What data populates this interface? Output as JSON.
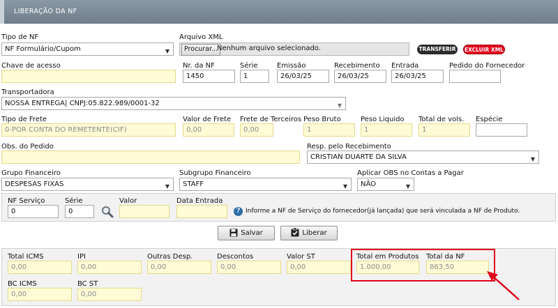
{
  "header": {
    "title": "LIBERAÇÃO DA NF"
  },
  "row1": {
    "tipo_nf": {
      "label": "Tipo de NF",
      "value": "NF Formulário/Cupom"
    },
    "arquivo_xml": {
      "label": "Arquivo XML",
      "button": "Procurar...",
      "status": "Nenhum arquivo selecionado."
    },
    "transferir": "TRANSFERIR",
    "excluir_xml": "EXCLUIR XML"
  },
  "row2": {
    "chave": {
      "label": "Chave de acesso",
      "value": ""
    },
    "nr_nf": {
      "label": "Nr. da NF",
      "value": "1450"
    },
    "serie": {
      "label": "Série",
      "value": "1"
    },
    "emissao": {
      "label": "Emissão",
      "value": "26/03/25"
    },
    "recebimento": {
      "label": "Recebimento",
      "value": "26/03/25"
    },
    "entrada": {
      "label": "Entrada",
      "value": "26/03/25"
    },
    "pedido": {
      "label": "Pedido do Fornecedor",
      "value": ""
    }
  },
  "row3": {
    "transportadora": {
      "label": "Transportadora",
      "value": "NOSSA ENTREGA| CNPJ:05.822.989/0001-32"
    }
  },
  "row4": {
    "tipo_frete": {
      "label": "Tipo de Frete",
      "value": "0-POR CONTA DO REMETENTE(CIF)"
    },
    "valor_frete": {
      "label": "Valor de Frete",
      "value": "0,00"
    },
    "frete_terceiros": {
      "label": "Frete de Terceiros",
      "value": "0,00"
    },
    "peso_bruto": {
      "label": "Peso Bruto",
      "value": "1"
    },
    "peso_liquido": {
      "label": "Peso Liquido",
      "value": "1"
    },
    "total_vols": {
      "label": "Total de vols.",
      "value": "1"
    },
    "especie": {
      "label": "Espécie",
      "value": ""
    }
  },
  "row5": {
    "obs": {
      "label": "Obs. do Pedido",
      "value": ""
    },
    "resp": {
      "label": "Resp. pelo Recebimento",
      "value": "CRISTIAN DUARTE DA SILVA"
    }
  },
  "row6": {
    "grupo": {
      "label": "Grupo Financeiro",
      "value": "DESPESAS FIXAS"
    },
    "subgrupo": {
      "label": "Subgrupo Financeiro",
      "value": "STAFF"
    },
    "aplicar_obs": {
      "label": "Aplicar OBS no Contas a Pagar",
      "value": "NÃO"
    }
  },
  "servico": {
    "nf_servico": {
      "label": "NF Serviço",
      "value": "0"
    },
    "serie": {
      "label": "Série",
      "value": "0"
    },
    "valor": {
      "label": "Valor",
      "value": ""
    },
    "data_entrada": {
      "label": "Data Entrada",
      "value": ""
    },
    "info_text": "Informe a NF de Serviço do fornecedor(já lançada) que será vinculada a NF de Produto."
  },
  "actions": {
    "salvar": "Salvar",
    "liberar": "Liberar"
  },
  "totals": {
    "total_icms": {
      "label": "Total ICMS",
      "value": "0,00"
    },
    "ipi": {
      "label": "IPI",
      "value": "0,00"
    },
    "outras": {
      "label": "Outras Desp.",
      "value": "0,00"
    },
    "descontos": {
      "label": "Descontos",
      "value": "0,00"
    },
    "valor_st": {
      "label": "Valor ST",
      "value": "0,00"
    },
    "total_produtos": {
      "label": "Total em Produtos",
      "value": "1.000,00"
    },
    "total_nf": {
      "label": "Total da NF",
      "value": "863,50"
    },
    "bc_icms": {
      "label": "BC ICMS",
      "value": "0,00"
    },
    "bc_st": {
      "label": "BC ST",
      "value": "0,00"
    }
  },
  "colors": {
    "header": "#7a8794",
    "highlight": "#e0001a",
    "field_yellow": "#fffbd6",
    "transferir": "#2b2b2b",
    "excluir": "#e3001b"
  }
}
